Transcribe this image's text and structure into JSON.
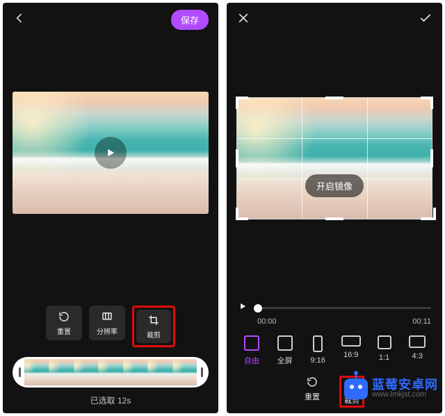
{
  "left": {
    "save_label": "保存",
    "tools": {
      "reset": "重置",
      "resolution": "分辨率",
      "crop": "裁剪"
    },
    "selected_text": "已选取 12s"
  },
  "right": {
    "mirror_label": "开启镜像",
    "time_start": "00:00",
    "time_end": "00:11",
    "ratios": {
      "free": "自由",
      "full": "全屏",
      "r916": "9:16",
      "r169": "16:9",
      "r11": "1:1",
      "r43": "4:3"
    },
    "bottom": {
      "reset": "重置",
      "crop": "裁剪"
    }
  },
  "watermark": {
    "title": "蓝莓安卓网",
    "url": "www.lmkjst.com"
  }
}
